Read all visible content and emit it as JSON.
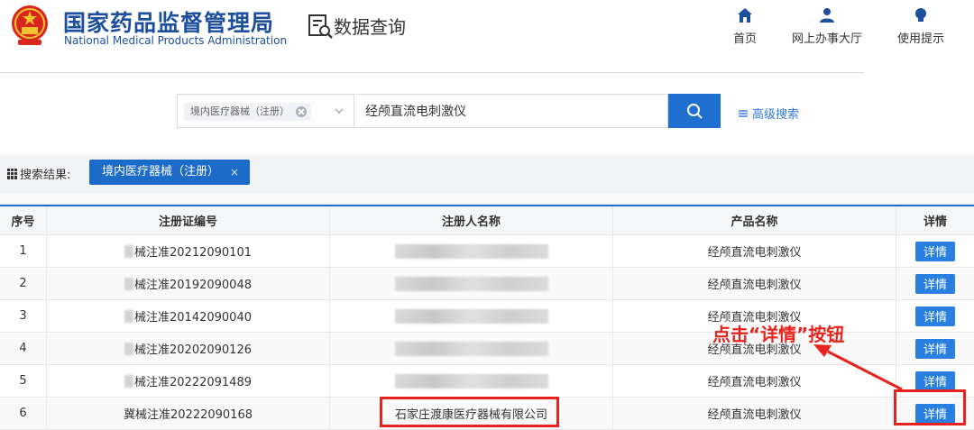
{
  "header": {
    "brand_cn": "国家药品监督管理局",
    "brand_en": "National Medical Products Administration",
    "section_title": "数据查询",
    "nav": [
      {
        "label": "首页",
        "icon": "home-icon"
      },
      {
        "label": "网上办事大厅",
        "icon": "user-icon"
      },
      {
        "label": "使用提示",
        "icon": "lightbulb-icon"
      }
    ]
  },
  "search": {
    "category_tag": "境内医疗器械（注册）",
    "query": "经颅直流电刺激仪",
    "advanced_label": "高级搜索"
  },
  "results": {
    "label": "搜索结果:",
    "active_tag": "境内医疗器械（注册）",
    "close_glyph": "×"
  },
  "table": {
    "headers": [
      "序号",
      "注册证编号",
      "注册人名称",
      "产品名称",
      "详情"
    ],
    "rows": [
      {
        "no": "1",
        "cert": "械注准20212090101",
        "registrant": "",
        "product": "经颅直流电刺激仪",
        "detail": "详情"
      },
      {
        "no": "2",
        "cert": "械注准20192090048",
        "registrant": "",
        "product": "经颅直流电刺激仪",
        "detail": "详情"
      },
      {
        "no": "3",
        "cert": "械注准20142090040",
        "registrant": "",
        "product": "经颅直流电刺激仪",
        "detail": "详情"
      },
      {
        "no": "4",
        "cert": "械注准20202090126",
        "registrant": "",
        "product": "经颅直流电刺激仪",
        "detail": "详情"
      },
      {
        "no": "5",
        "cert": "械注准20222091489",
        "registrant": "",
        "product": "经颅直流电刺激仪",
        "detail": "详情"
      },
      {
        "no": "6",
        "cert": "冀械注准20222090168",
        "registrant": "石家庄渡康医疗器械有限公司",
        "product": "经颅直流电刺激仪",
        "detail": "详情"
      }
    ]
  },
  "annotation": {
    "text": "点击“详情”按钮",
    "color": "#e8231e"
  },
  "colors": {
    "brand": "#1d4f9c",
    "primary": "#1e6fd0",
    "button": "#2a80e0"
  }
}
